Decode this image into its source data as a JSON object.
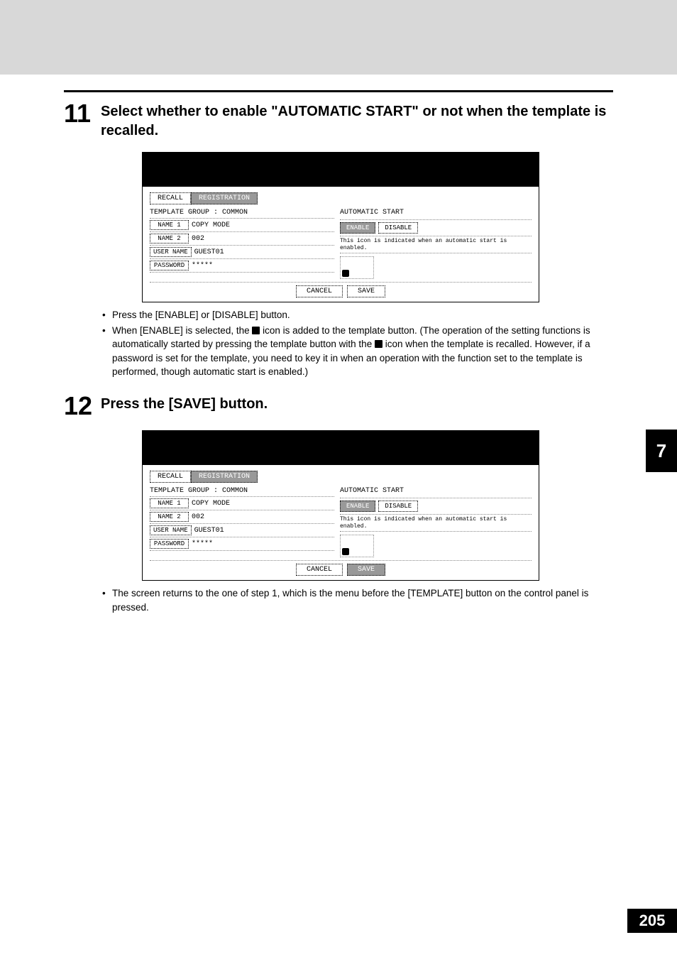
{
  "step11": {
    "num": "11",
    "heading": "Select whether to enable \"AUTOMATIC START\" or not when the template is recalled.",
    "bullets": [
      "Press the [ENABLE] or [DISABLE] button.",
      "When [ENABLE] is selected, the  icon is added to the template button. (The operation of the setting functions is automatically started by pressing the template button with the  icon when the template is recalled. However, if a password is set for the template, you need to key it in when an operation with the function set to the template is performed, though automatic start is enabled.)"
    ]
  },
  "step12": {
    "num": "12",
    "heading": "Press the [SAVE] button.",
    "bullets": [
      "The screen returns to the one of step 1, which is the menu before the [TEMPLATE] button on the control panel is pressed."
    ]
  },
  "lcd": {
    "tab_recall": "RECALL",
    "tab_registration": "REGISTRATION",
    "template_group_line": "TEMPLATE GROUP   : COMMON",
    "name1_label": "NAME 1",
    "name1_val": "COPY MODE",
    "name2_label": "NAME 2",
    "name2_val": "002",
    "username_label": "USER NAME",
    "username_val": "GUEST01",
    "password_label": "PASSWORD",
    "password_val": "*****",
    "auto_start": "AUTOMATIC START",
    "enable": "ENABLE",
    "disable": "DISABLE",
    "hint": "This icon is indicated when an automatic start is enabled.",
    "cancel": "CANCEL",
    "save": "SAVE"
  },
  "side_tab": "7",
  "page_number": "205"
}
